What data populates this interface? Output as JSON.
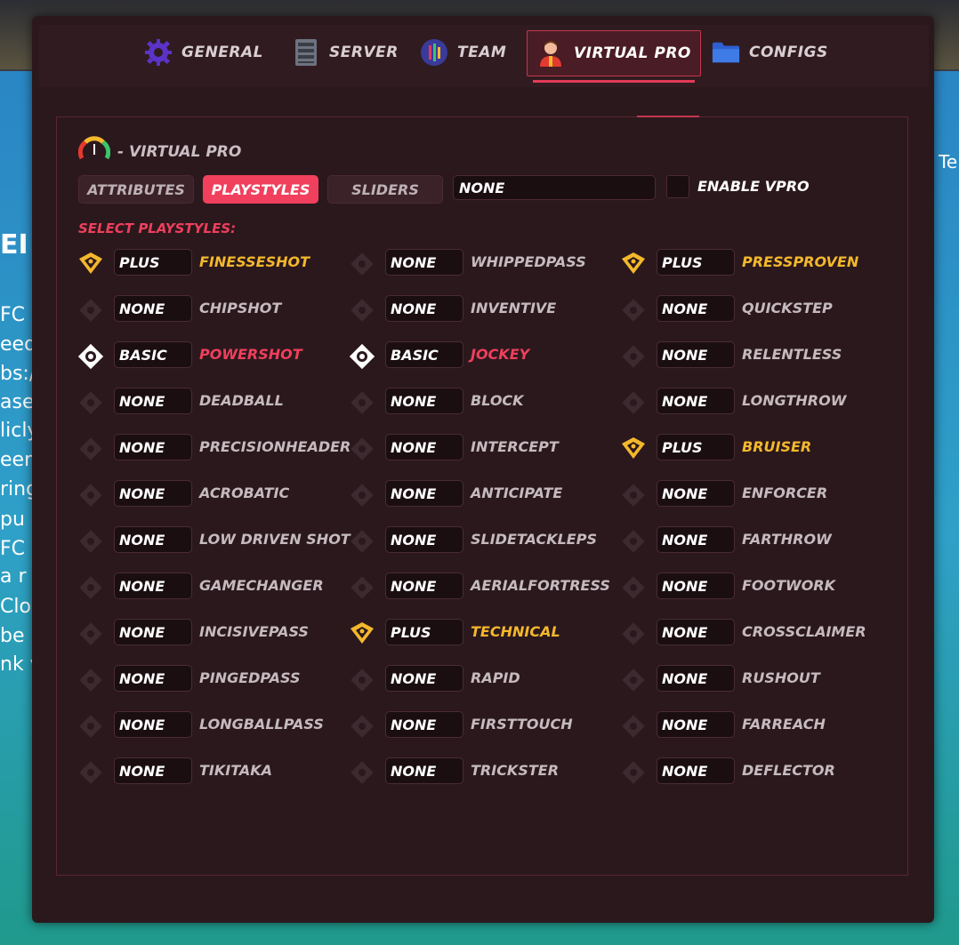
{
  "tabs": [
    {
      "label": "GENERAL",
      "icon": "gear-icon"
    },
    {
      "label": "SERVER",
      "icon": "server-icon"
    },
    {
      "label": "TEAM",
      "icon": "team-icon"
    },
    {
      "label": "VIRTUAL PRO",
      "icon": "player-icon",
      "active": true
    },
    {
      "label": "CONFIGS",
      "icon": "folder-icon"
    }
  ],
  "panel": {
    "title": "- VIRTUAL PRO",
    "subtabs": [
      "ATTRIBUTES",
      "PLAYSTYLES",
      "SLIDERS"
    ],
    "active_subtab": "PLAYSTYLES",
    "preset_value": "NONE",
    "enable_label": "ENABLE VPRO",
    "enable_checked": false,
    "section_title": "SELECT PLAYSTYLES:"
  },
  "colors": {
    "accent": "#ef3f5c",
    "plus": "#f3b82c",
    "basic": "#ef3f5c",
    "none": "#c5bbbf"
  },
  "playstyles": [
    [
      {
        "level": "PLUS",
        "name": "FINESSESHOT"
      },
      {
        "level": "NONE",
        "name": "CHIPSHOT"
      },
      {
        "level": "BASIC",
        "name": "POWERSHOT"
      },
      {
        "level": "NONE",
        "name": "DEADBALL"
      },
      {
        "level": "NONE",
        "name": "PRECISIONHEADER"
      },
      {
        "level": "NONE",
        "name": "ACROBATIC"
      },
      {
        "level": "NONE",
        "name": "LOW DRIVEN SHOT"
      },
      {
        "level": "NONE",
        "name": "GAMECHANGER"
      },
      {
        "level": "NONE",
        "name": "INCISIVEPASS"
      },
      {
        "level": "NONE",
        "name": "PINGEDPASS"
      },
      {
        "level": "NONE",
        "name": "LONGBALLPASS"
      },
      {
        "level": "NONE",
        "name": "TIKITAKA"
      }
    ],
    [
      {
        "level": "NONE",
        "name": "WHIPPEDPASS"
      },
      {
        "level": "NONE",
        "name": "INVENTIVE"
      },
      {
        "level": "BASIC",
        "name": "JOCKEY"
      },
      {
        "level": "NONE",
        "name": "BLOCK"
      },
      {
        "level": "NONE",
        "name": "INTERCEPT"
      },
      {
        "level": "NONE",
        "name": "ANTICIPATE"
      },
      {
        "level": "NONE",
        "name": "SLIDETACKLEPS"
      },
      {
        "level": "NONE",
        "name": "AERIALFORTRESS"
      },
      {
        "level": "PLUS",
        "name": "TECHNICAL"
      },
      {
        "level": "NONE",
        "name": "RAPID"
      },
      {
        "level": "NONE",
        "name": "FIRSTTOUCH"
      },
      {
        "level": "NONE",
        "name": "TRICKSTER"
      }
    ],
    [
      {
        "level": "PLUS",
        "name": "PRESSPROVEN"
      },
      {
        "level": "NONE",
        "name": "QUICKSTEP"
      },
      {
        "level": "NONE",
        "name": "RELENTLESS"
      },
      {
        "level": "NONE",
        "name": "LONGTHROW"
      },
      {
        "level": "PLUS",
        "name": "BRUISER"
      },
      {
        "level": "NONE",
        "name": "ENFORCER"
      },
      {
        "level": "NONE",
        "name": "FARTHROW"
      },
      {
        "level": "NONE",
        "name": "FOOTWORK"
      },
      {
        "level": "NONE",
        "name": "CROSSCLAIMER"
      },
      {
        "level": "NONE",
        "name": "RUSHOUT"
      },
      {
        "level": "NONE",
        "name": "FARREACH"
      },
      {
        "level": "NONE",
        "name": "DEFLECTOR"
      }
    ]
  ],
  "background": {
    "left_fragments": [
      "EI",
      "FC",
      "eed",
      "bs:/",
      "ase",
      "licly",
      "een",
      "ring",
      "pu",
      "FC",
      "a r",
      "Clos",
      "be",
      "nk v"
    ],
    "right_fragment": "Te"
  }
}
